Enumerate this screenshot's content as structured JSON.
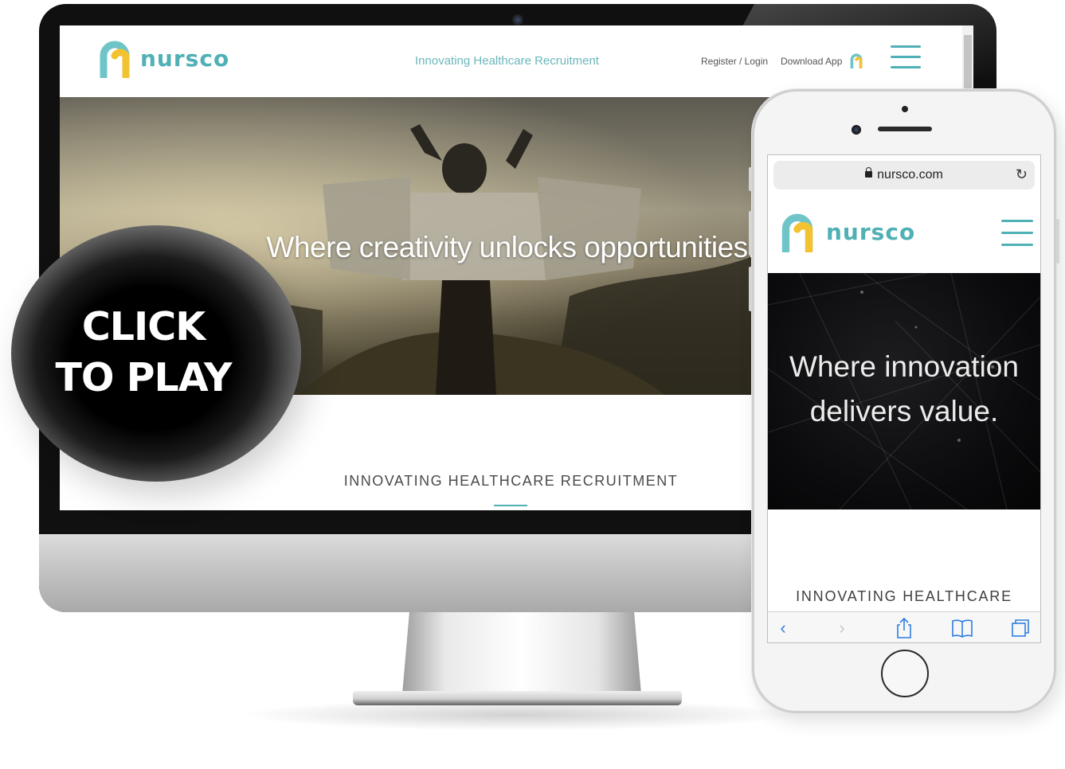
{
  "desktop": {
    "logo_text": "nursco",
    "tagline": "Innovating Healthcare Recruitment",
    "nav": {
      "register_login": "Register / Login",
      "download_app": "Download App"
    },
    "hero_text": "Where creativity unlocks opportunities.",
    "section_title": "INNOVATING HEALTHCARE RECRUITMENT"
  },
  "phone": {
    "url": "nursco.com",
    "logo_text": "nursco",
    "hero_line_1": "Where innovation",
    "hero_line_2": "delivers value.",
    "section_title": "INNOVATING HEALTHCARE",
    "toolbar_icons": [
      "back-icon",
      "forward-icon",
      "share-icon",
      "bookmarks-icon",
      "tabs-icon"
    ]
  },
  "overlay": {
    "line_1": "CLICK",
    "line_2": "TO PLAY"
  },
  "colors": {
    "brand_teal": "#4fb0b5",
    "brand_yellow": "#f2c230",
    "ios_blue": "#2f7fe0"
  }
}
